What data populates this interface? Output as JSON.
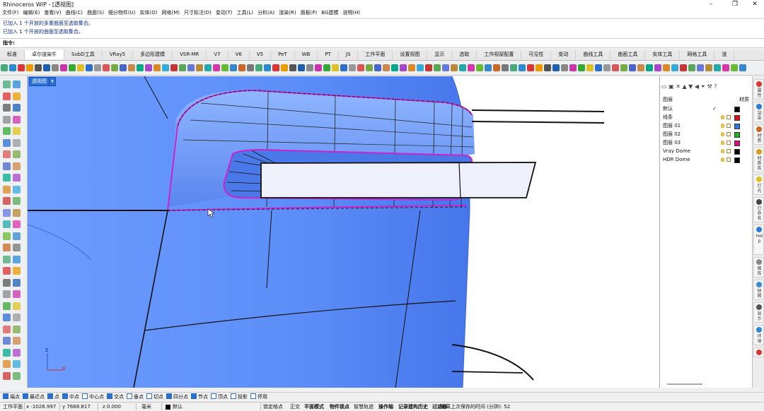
{
  "window": {
    "title": "Rhinoceros WIP - [透视图]"
  },
  "menu": [
    "文件(F)",
    "编辑(E)",
    "查看(V)",
    "曲线(C)",
    "曲面(S)",
    "细分物件(U)",
    "实体(O)",
    "网格(M)",
    "尺寸标注(D)",
    "变动(T)",
    "工具(L)",
    "分析(A)",
    "渲染(R)",
    "面板(P)",
    "BG建模",
    "说明(H)"
  ],
  "history": [
    "已加入 1 个开放的多重曲面至选取集合。",
    "已加入 1 个开放的曲面至选取集合。"
  ],
  "command": {
    "label": "指令:"
  },
  "tabs": [
    "标准",
    "卓尔渲染牛",
    "SubD工具",
    "VRay5",
    "多边形建模",
    "VSR-MR",
    "V7",
    "V6",
    "V5",
    "PeT",
    "WB",
    "PT",
    "JS",
    "工作平面",
    "设置视图",
    "显示",
    "选取",
    "工作视窗配置",
    "可见性",
    "变动",
    "曲线工具",
    "曲面工具",
    "实体工具",
    "网格工具",
    "渲"
  ],
  "active_tab": 1,
  "viewport": {
    "name": "透视图",
    "axes": {
      "x": "x",
      "z": "z"
    }
  },
  "layers_panel": {
    "header": {
      "name_col": "图层",
      "material_col": "材质"
    },
    "layers": [
      {
        "name": "默认",
        "check": "✓",
        "color": "#000000",
        "show_icons": false
      },
      {
        "name": "线条",
        "color": "#e01010",
        "show_icons": true
      },
      {
        "name": "图层 01",
        "color": "#2878d8",
        "show_icons": true
      },
      {
        "name": "图层 02",
        "color": "#20b020",
        "show_icons": true
      },
      {
        "name": "图层 03",
        "color": "#e0107a",
        "show_icons": true
      },
      {
        "name": "Vray Dome",
        "color": "#000000",
        "show_icons": true
      },
      {
        "name": "HDR Dome",
        "color": "#000000",
        "show_icons": true
      }
    ]
  },
  "side_tabs": [
    {
      "label": "属性",
      "color": "#d33"
    },
    {
      "label": "渲染",
      "color": "#2a7ad8"
    },
    {
      "label": "材质",
      "color": "#c62"
    },
    {
      "label": "材质库",
      "color": "#d8a020"
    },
    {
      "label": "灯光",
      "color": "#e0c020"
    },
    {
      "label": "已命名",
      "color": "#444"
    },
    {
      "label": "Help",
      "color": "#2a7ad8"
    },
    {
      "label": "图库",
      "color": "#888"
    },
    {
      "label": "快照",
      "color": "#3a8ad8"
    },
    {
      "label": "显示",
      "color": "#555"
    },
    {
      "label": "环境",
      "color": "#2a8ad8"
    },
    {
      "label": "",
      "color": "#d33"
    }
  ],
  "osnaps": [
    {
      "label": "端点",
      "on": true
    },
    {
      "label": "最近点",
      "on": true
    },
    {
      "label": "点",
      "on": true
    },
    {
      "label": "中点",
      "on": true
    },
    {
      "label": "中心点",
      "on": false
    },
    {
      "label": "交点",
      "on": true
    },
    {
      "label": "垂点",
      "on": false
    },
    {
      "label": "切点",
      "on": false
    },
    {
      "label": "四分点",
      "on": true
    },
    {
      "label": "节点",
      "on": true
    },
    {
      "label": "顶点",
      "on": false
    },
    {
      "label": "投影",
      "on": false
    },
    {
      "label": "停用",
      "on": false
    }
  ],
  "status": {
    "cplane": "工作平面",
    "x": "x -1026.997",
    "y": "y 7668.817",
    "z": "z 0.000",
    "units": "毫米",
    "layer": "默认",
    "layer_color": "#000000",
    "toggles": [
      "锁定格点",
      "正交",
      "平面模式",
      "物件锁点",
      "智慧轨迹",
      "操作轴",
      "记录建构历史",
      "过滤器"
    ],
    "saved": "距离上次保存的时间 (分钟): 52"
  }
}
